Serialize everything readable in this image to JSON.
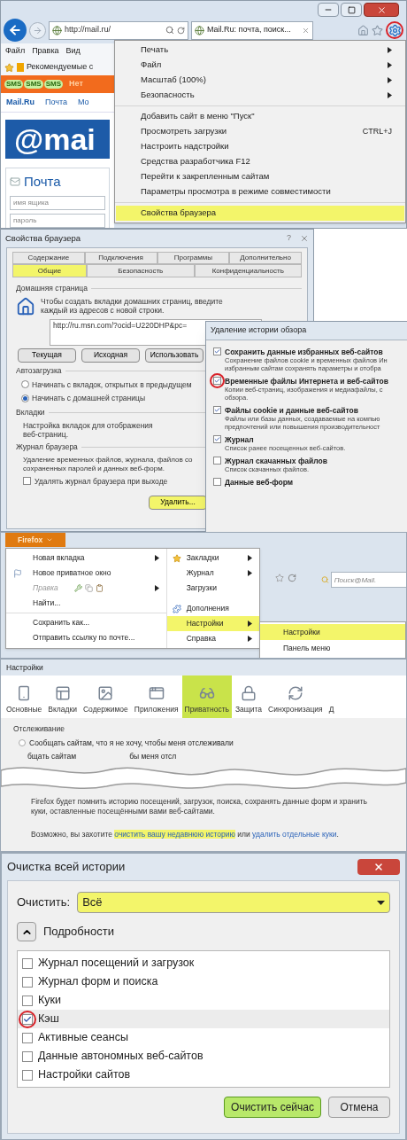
{
  "ie_window": {
    "address": "http://mail.ru/",
    "tab_title": "Mail.Ru: почта, поиск...",
    "settings_circled": true,
    "menu_bar": [
      "Файл",
      "Правка",
      "Вид"
    ],
    "favorites_item": "Рекомендуемые с",
    "banner": {
      "badges": [
        "SMS",
        "SMS",
        "SMS"
      ],
      "text": "Нет"
    },
    "site_nav": [
      "Mail.Ru",
      "Почта",
      "Мо"
    ],
    "logo": "@mai",
    "login": {
      "title": "Почта",
      "fields": [
        {
          "placeholder": "имя ящика"
        },
        {
          "placeholder": "пароль"
        }
      ]
    },
    "tools_menu": {
      "groups": [
        [
          {
            "label": "Печать",
            "kind": "submenu",
            "selected": false
          },
          {
            "label": "Файл",
            "kind": "submenu",
            "selected": false
          },
          {
            "label": "Масштаб (100%)",
            "kind": "submenu",
            "selected": false
          },
          {
            "label": "Безопасность",
            "kind": "submenu",
            "selected": false
          }
        ],
        [
          {
            "label": "Добавить сайт в меню \"Пуск\"",
            "kind": "plain",
            "selected": false
          },
          {
            "label": "Просмотреть загрузки",
            "kind": "shortcut",
            "shortcut": "CTRL+J",
            "selected": false
          },
          {
            "label": "Настроить надстройки",
            "kind": "plain",
            "selected": false
          },
          {
            "label": "Средства разработчика F12",
            "kind": "plain",
            "selected": false
          },
          {
            "label": "Перейти к закрепленным сайтам",
            "kind": "plain",
            "selected": false
          },
          {
            "label": "Параметры просмотра в режиме совместимости",
            "kind": "plain",
            "selected": false
          }
        ],
        [
          {
            "label": "Свойства браузера",
            "kind": "plain",
            "selected": true
          }
        ]
      ]
    }
  },
  "internet_options": {
    "title": "Свойства браузера",
    "help": "?",
    "tabs_back": [
      {
        "label": "Содержание",
        "selected": false
      },
      {
        "label": "Подключения",
        "selected": false
      },
      {
        "label": "Программы",
        "selected": false
      },
      {
        "label": "Дополнительно",
        "selected": false
      }
    ],
    "tabs_front": [
      {
        "label": "Общие",
        "selected": true
      },
      {
        "label": "Безопасность",
        "selected": false
      },
      {
        "label": "Конфиденциальность",
        "selected": false
      }
    ],
    "home_page": {
      "legend": "Домашняя страница",
      "hint": "Чтобы создать вкладки домашних страниц, введите каждый из адресов с новой строки.",
      "url": "http://ru.msn.com/?ocid=U220DHP&pc=",
      "buttons": [
        "Текущая",
        "Исходная",
        "Использовать"
      ]
    },
    "startup": {
      "legend": "Автозагрузка",
      "options": [
        {
          "label": "Начинать с вкладок, открытых в предыдущем",
          "selected": false
        },
        {
          "label": "Начинать с домашней страницы",
          "selected": true
        }
      ]
    },
    "tabs_section": {
      "legend": "Вкладки",
      "text": "Настройка вкладок для отображения веб-страниц."
    },
    "history": {
      "legend": "Журнал браузера",
      "lines": [
        "Удаление временных файлов, журнала, файлов со",
        "сохраненных паролей и данных веб-форм."
      ],
      "on_exit": {
        "label": "Удалять журнал браузера при выходе",
        "checked": false
      },
      "delete_button": {
        "label": "Удалить...",
        "highlighted": true
      }
    }
  },
  "delete_history": {
    "title": "Удаление истории обзора",
    "items": [
      {
        "title": "Сохранить данные избранных веб-сайтов",
        "lines": [
          "Сохранение файлов cookie и временных файлов Ин",
          "избранным сайтам сохранять параметры и отобра"
        ],
        "checked": true,
        "circled": false
      },
      {
        "title": "Временные файлы Интернета и веб-сайтов",
        "lines": [
          "Копии веб-страниц, изображения и медиафайлы, с",
          "обзора."
        ],
        "checked": true,
        "circled": true
      },
      {
        "title": "Файлы cookie и данные веб-сайтов",
        "lines": [
          "Файлы или базы данных, создаваемые на компью",
          "предпочтений или повышения производительност"
        ],
        "checked": true,
        "circled": false
      },
      {
        "title": "Журнал",
        "lines": [
          "Список ранее посещенных веб-сайтов."
        ],
        "checked": true,
        "circled": false
      },
      {
        "title": "Журнал скачанных файлов",
        "lines": [
          "Список скачанных файлов."
        ],
        "checked": false,
        "circled": false
      },
      {
        "title": "Данные веб-форм",
        "checked": false,
        "circled": false
      }
    ]
  },
  "firefox_menu": {
    "button": "Firefox",
    "search_placeholder": "Поиск@Mail.",
    "left": [
      [
        {
          "label": "Новая вкладка",
          "kind": "submenu",
          "disabled": false
        },
        {
          "label": "Новое приватное окно",
          "kind": "private",
          "disabled": false
        },
        {
          "label": "Правка",
          "kind": "edit",
          "disabled": true
        },
        {
          "label": "Найти...",
          "kind": "plain",
          "disabled": false
        }
      ],
      [
        {
          "label": "Сохранить как...",
          "kind": "plain",
          "disabled": false
        },
        {
          "label": "Отправить ссылку по почте...",
          "kind": "plain",
          "disabled": false
        }
      ]
    ],
    "right": [
      [
        {
          "label": "Закладки",
          "kind": "bookmarks",
          "selected": false
        },
        {
          "label": "Журнал",
          "kind": "submenu",
          "selected": false
        },
        {
          "label": "Загрузки",
          "kind": "plain",
          "selected": false
        }
      ],
      [
        {
          "label": "Дополнения",
          "kind": "addons",
          "selected": false
        },
        {
          "label": "Настройки",
          "kind": "submenu",
          "selected": true
        },
        {
          "label": "Справка",
          "kind": "submenu",
          "selected": false
        }
      ]
    ],
    "submenu": [
      {
        "label": "Настройки",
        "selected": true
      },
      {
        "label": "Панель меню",
        "selected": false
      }
    ]
  },
  "options_window": {
    "title": "Настройки",
    "panes": [
      {
        "label": "Основные",
        "kind": "general",
        "selected": false
      },
      {
        "label": "Вкладки",
        "kind": "tabs",
        "selected": false
      },
      {
        "label": "Содержимое",
        "kind": "content",
        "selected": false
      },
      {
        "label": "Приложения",
        "kind": "apps",
        "selected": false
      },
      {
        "label": "Приватность",
        "kind": "privacy",
        "selected": true
      },
      {
        "label": "Защита",
        "kind": "security",
        "selected": false
      },
      {
        "label": "Синхронизация",
        "kind": "sync",
        "selected": false
      },
      {
        "label": "Д",
        "kind": "more",
        "selected": false
      }
    ],
    "tracking": {
      "legend": "Отслеживание",
      "option": "Сообщать сайтам, что я не хочу, чтобы меня отслеживали",
      "option_selected": false,
      "partial": [
        "бщать сайтам",
        "бы меня отсл"
      ]
    },
    "history_text": "Firefox будет помнить историю посещений, загрузок, поиска, сохранять данные форм и хранить куки, оставленные посещёнными вами веб-сайтами.",
    "links_line": {
      "prefix": "Возможно, вы захотите",
      "link1": {
        "label": "очистить вашу недавнюю историю",
        "highlighted": true
      },
      "middle": "или",
      "link2": {
        "label": "удалить отдельные куки",
        "highlighted": false
      },
      "suffix": "."
    }
  },
  "clear_history": {
    "title": "Очистка всей истории",
    "range_label": "Очистить:",
    "range": {
      "value": "Всё",
      "highlighted": true
    },
    "details": {
      "label": "Подробности",
      "expanded": true
    },
    "items": [
      {
        "label": "Журнал посещений и загрузок",
        "checked": false,
        "circled": false
      },
      {
        "label": "Журнал форм и поиска",
        "checked": false,
        "circled": false
      },
      {
        "label": "Куки",
        "checked": false,
        "circled": false
      },
      {
        "label": "Кэш",
        "checked": true,
        "circled": true
      },
      {
        "label": "Активные сеансы",
        "checked": false,
        "circled": false
      },
      {
        "label": "Данные автономных веб-сайтов",
        "checked": false,
        "circled": false
      },
      {
        "label": "Настройки сайтов",
        "checked": false,
        "circled": false
      }
    ],
    "buttons": [
      {
        "label": "Очистить сейчас",
        "kind": "primary"
      },
      {
        "label": "Отмена",
        "kind": "secondary"
      }
    ]
  }
}
